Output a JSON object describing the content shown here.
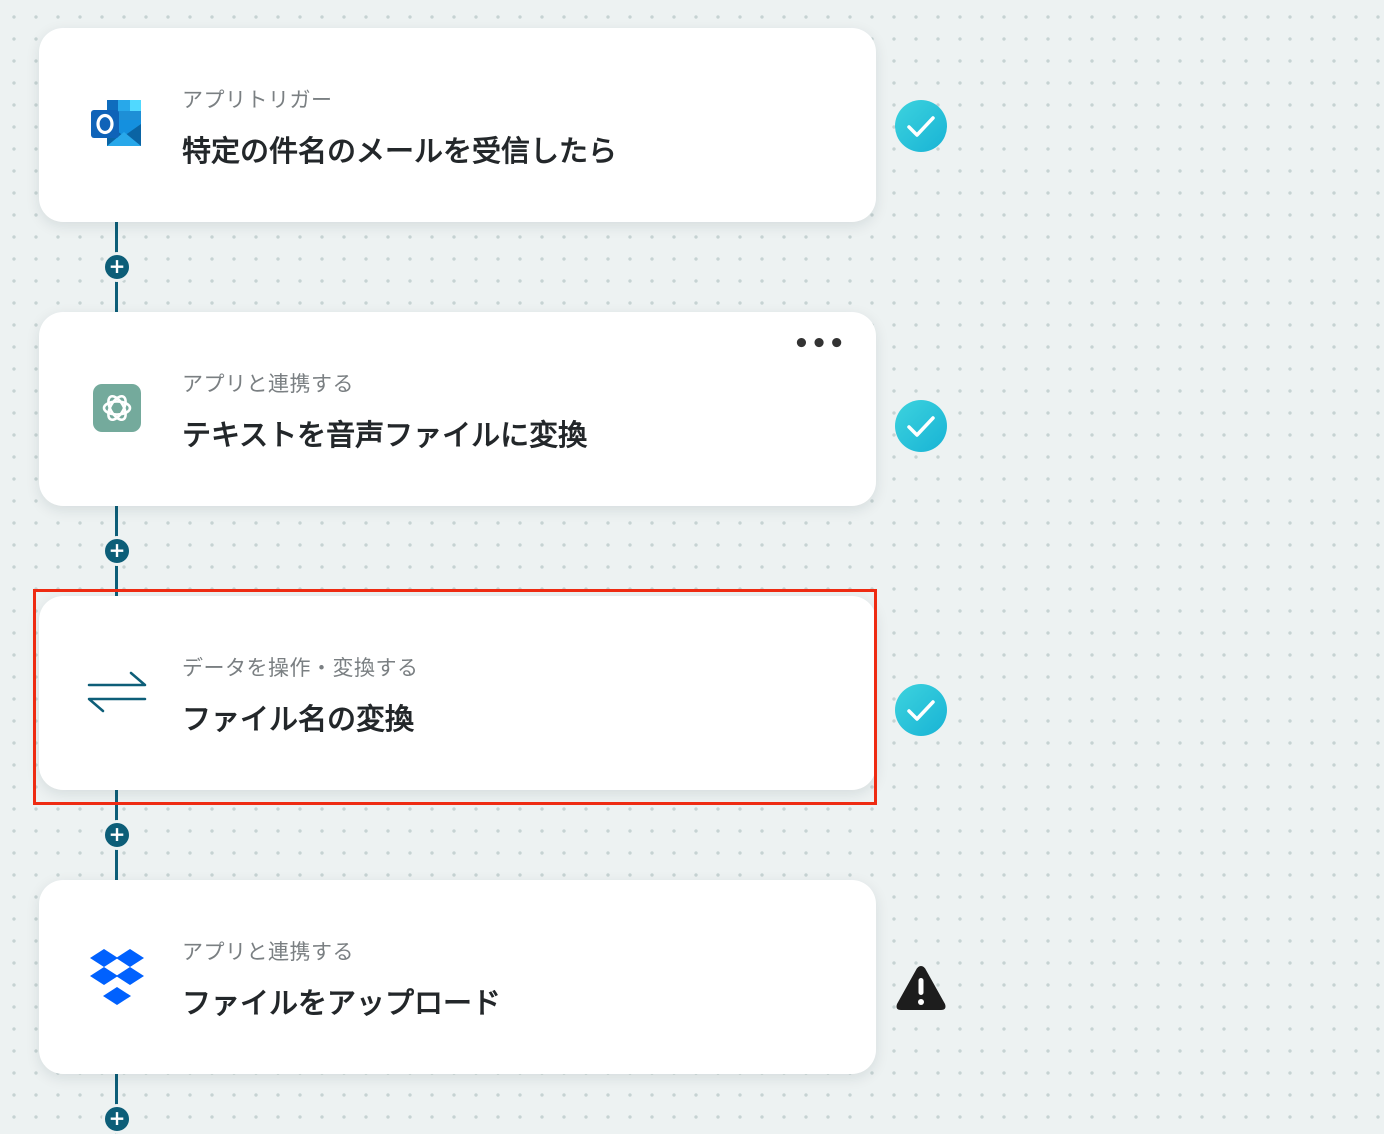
{
  "steps": [
    {
      "subtitle": "アプリトリガー",
      "title": "特定の件名のメールを受信したら",
      "icon": "outlook-icon",
      "status": "success"
    },
    {
      "subtitle": "アプリと連携する",
      "title": "テキストを音声ファイルに変換",
      "icon": "openai-icon",
      "status": "success"
    },
    {
      "subtitle": "データを操作・変換する",
      "title": "ファイル名の変換",
      "icon": "convert-arrows-icon",
      "status": "success"
    },
    {
      "subtitle": "アプリと連携する",
      "title": "ファイルをアップロード",
      "icon": "dropbox-icon",
      "status": "warning"
    }
  ],
  "menu_label": "•••",
  "add_label": "+",
  "colors": {
    "accent": "#0d5e78",
    "success_start": "#33cddc",
    "success_end": "#1fb8d6",
    "highlight": "#ee2b12",
    "warning": "#1d1d1d"
  }
}
